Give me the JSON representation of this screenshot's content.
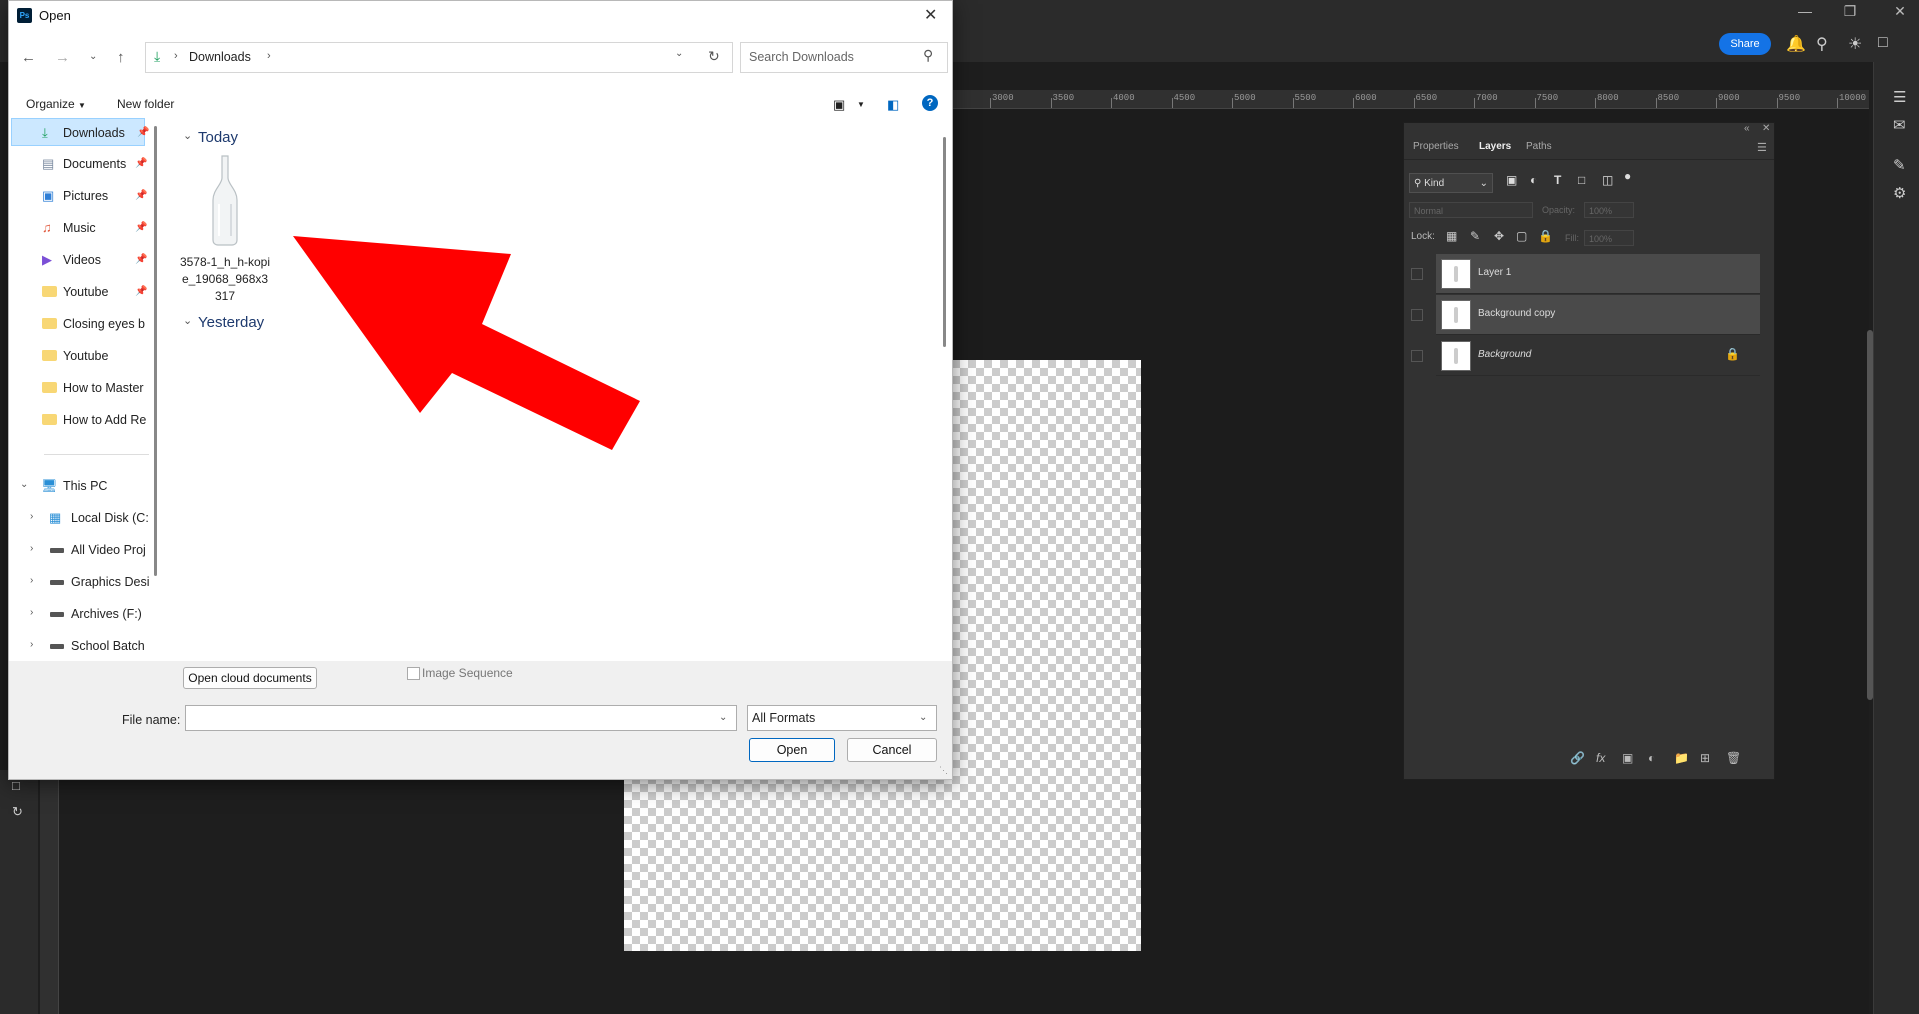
{
  "dialog": {
    "title": "Open",
    "app_icon_text": "Ps",
    "breadcrumb": [
      "Downloads"
    ],
    "search_placeholder": "Search Downloads",
    "organize_label": "Organize",
    "new_folder_label": "New folder",
    "nav": {
      "items": [
        {
          "label": "Downloads",
          "icon": "download-icon",
          "pinned": true,
          "selected": true
        },
        {
          "label": "Documents",
          "icon": "document-icon",
          "pinned": true
        },
        {
          "label": "Pictures",
          "icon": "pictures-icon",
          "pinned": true
        },
        {
          "label": "Music",
          "icon": "music-icon",
          "pinned": true
        },
        {
          "label": "Videos",
          "icon": "video-icon",
          "pinned": true
        },
        {
          "label": "Youtube",
          "icon": "folder-icon",
          "pinned": true
        },
        {
          "label": "Closing eyes b",
          "icon": "folder-icon"
        },
        {
          "label": "Youtube",
          "icon": "folder-icon"
        },
        {
          "label": "How to Master",
          "icon": "folder-icon"
        },
        {
          "label": "How to Add Re",
          "icon": "folder-icon"
        }
      ],
      "this_pc": "This PC",
      "drives": [
        "Local Disk (C:",
        "All Video Proj",
        "Graphics Desi",
        "Archives (F:)",
        "School Batch"
      ]
    },
    "groups": [
      {
        "label": "Today",
        "files": [
          {
            "name": "3578-1_h_h-kopie_19068_968x3317",
            "icon": "bottle-file-icon"
          }
        ]
      },
      {
        "label": "Yesterday",
        "files": []
      }
    ],
    "open_cloud_label": "Open cloud documents",
    "image_sequence_label": "Image Sequence",
    "file_name_label": "File name:",
    "file_name_value": "",
    "format_value": "All Formats",
    "open_label": "Open",
    "cancel_label": "Cancel"
  },
  "photoshop": {
    "share_label": "Share",
    "ruler_marks": [
      "3000",
      "3500",
      "4000",
      "4500",
      "5000",
      "5500",
      "6000",
      "6500",
      "7000",
      "7500",
      "8000",
      "8500",
      "9000",
      "9500",
      "10000"
    ],
    "layers_panel": {
      "tabs": [
        "Properties",
        "Layers",
        "Paths"
      ],
      "active_tab": "Layers",
      "kind_label": "Kind",
      "blend_mode": "Normal",
      "opacity_label": "Opacity:",
      "opacity_value": "100%",
      "lock_label": "Lock:",
      "fill_label": "Fill:",
      "fill_value": "100%",
      "layers": [
        {
          "name": "Layer 1",
          "selected": true
        },
        {
          "name": "Background copy",
          "selected": true
        },
        {
          "name": "Background",
          "locked": true,
          "italic": true
        }
      ]
    }
  },
  "annotation": {
    "color": "#ff0000"
  }
}
